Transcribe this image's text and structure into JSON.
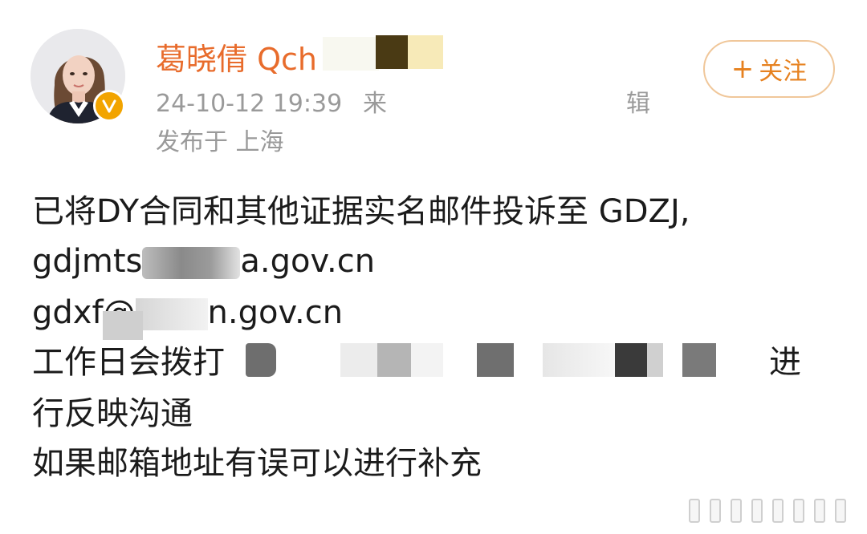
{
  "post": {
    "author": {
      "name_visible": "葛晓倩 Qch",
      "avatar_icon": "user-avatar-photo",
      "verified_icon": "v-badge-icon"
    },
    "timestamp": "24-10-12 19:39",
    "meta_partial": "来",
    "meta_edit_suffix": "辑",
    "location": "发布于 上海",
    "follow_button": {
      "plus": "+",
      "label": "关注"
    },
    "body": {
      "line1": "已将DY合同和其他证据实名邮件投诉至 GDZJ,",
      "line2_prefix": "gdjmts",
      "line2_suffix": "a.gov.cn",
      "line3_prefix": "gdxf@",
      "line3_suffix": "n.gov.cn",
      "line4_prefix": "工作日会拨打",
      "line4_suffix": "进",
      "line5": "行反映沟通",
      "line6": "如果邮箱地址有误可以进行补充"
    }
  },
  "colors": {
    "username": "#e86c2c",
    "follow_border": "#f0c79a",
    "follow_text": "#e6811f",
    "meta_text": "#9a9a9a",
    "body_text": "#1b1b1b",
    "verified_badge": "#f2a400"
  }
}
